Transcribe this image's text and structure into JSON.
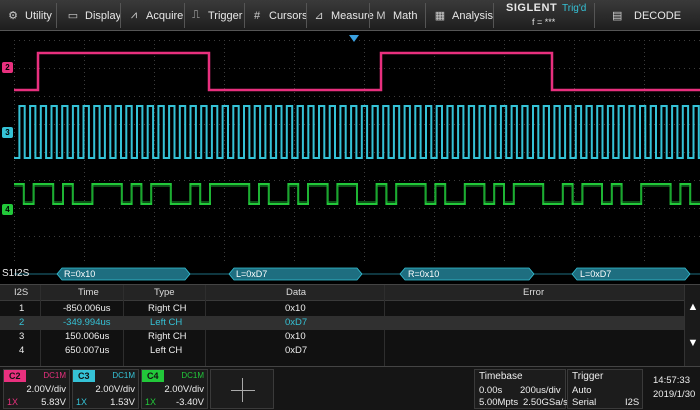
{
  "menu": [
    {
      "label": "Utility",
      "icon": "gear-icon"
    },
    {
      "label": "Display",
      "icon": "monitor-icon"
    },
    {
      "label": "Acquire",
      "icon": "acquire-icon"
    },
    {
      "label": "Trigger",
      "icon": "trigger-icon"
    },
    {
      "label": "Cursors",
      "icon": "cursors-icon"
    },
    {
      "label": "Measure",
      "icon": "measure-icon"
    },
    {
      "label": "Math",
      "icon": "math-icon"
    },
    {
      "label": "Analysis",
      "icon": "analysis-icon"
    }
  ],
  "brand": {
    "name": "SIGLENT",
    "trig_status": "Trig'd",
    "freq": "f = ***"
  },
  "decode_button": "DECODE",
  "channels_on_screen": {
    "c2": "2",
    "c3": "3",
    "c4": "4"
  },
  "bus": {
    "label": "S1I2S",
    "frames": [
      "R=0x10",
      "L=0xD7",
      "R=0x10",
      "L=0xD7"
    ]
  },
  "table": {
    "headers": [
      "I2S",
      "Time",
      "Type",
      "Data",
      "Error"
    ],
    "rows": [
      {
        "idx": "1",
        "time": "-850.006us",
        "type": "Right CH",
        "data": "0x10",
        "error": ""
      },
      {
        "idx": "2",
        "time": "-349.994us",
        "type": "Left CH",
        "data": "0xD7",
        "error": ""
      },
      {
        "idx": "3",
        "time": "150.006us",
        "type": "Right CH",
        "data": "0x10",
        "error": ""
      },
      {
        "idx": "4",
        "time": "650.007us",
        "type": "Left CH",
        "data": "0xD7",
        "error": ""
      }
    ],
    "selected_row": 2
  },
  "channels": [
    {
      "name": "C2",
      "coupling": "DC1M",
      "scale": "2.00V/div",
      "probe": "1X",
      "offset": "5.83V",
      "color": "#e8307e"
    },
    {
      "name": "C3",
      "coupling": "DC1M",
      "scale": "2.00V/div",
      "probe": "1X",
      "offset": "1.53V",
      "color": "#35c2d6"
    },
    {
      "name": "C4",
      "coupling": "DC1M",
      "scale": "2.00V/div",
      "probe": "1X",
      "offset": "-3.40V",
      "color": "#22c83a"
    }
  ],
  "timebase": {
    "title": "Timebase",
    "delay": "0.00s",
    "scale": "200us/div",
    "memory": "5.00Mpts",
    "rate": "2.50GSa/s"
  },
  "trigger": {
    "title": "Trigger",
    "mode": "Auto",
    "type": "Serial",
    "source": "I2S"
  },
  "clock": {
    "time": "14:57:33",
    "date": "2019/1/30"
  },
  "colors": {
    "c2": "#e8307e",
    "c3": "#35c2d6",
    "c4": "#22c83a",
    "bus": "#1e6e80"
  }
}
